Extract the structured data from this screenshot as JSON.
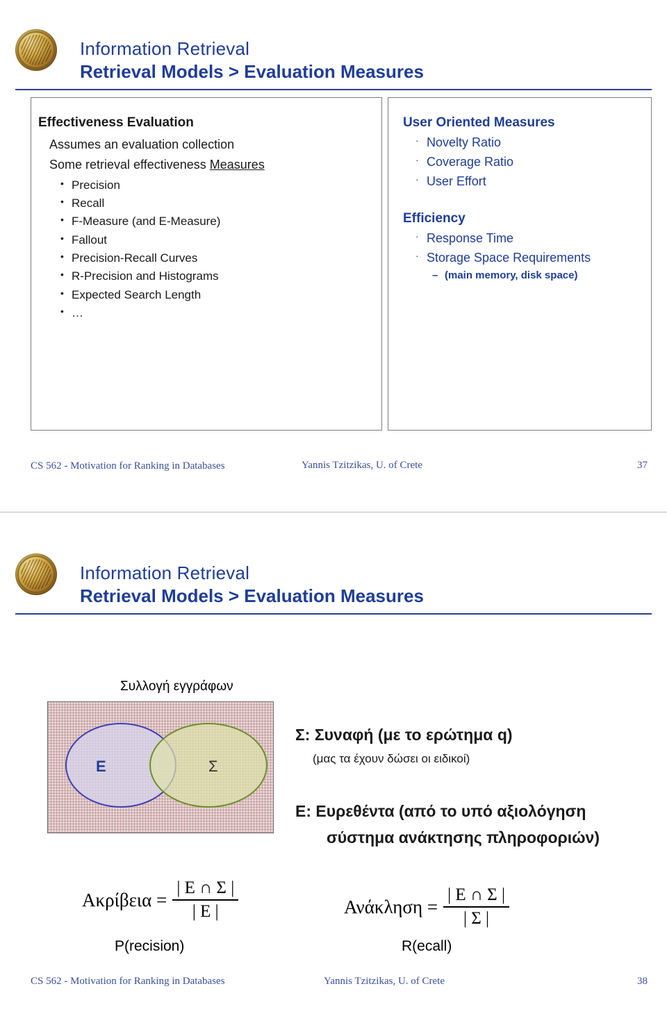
{
  "slide1": {
    "header": {
      "line1": "Information Retrieval",
      "line2": "Retrieval Models > Evaluation Measures"
    },
    "left_panel": {
      "heading": "Effectiveness Evaluation",
      "line_assumes": "Assumes an evaluation collection",
      "line_some_prefix": "Some retrieval effectiveness ",
      "line_some_underlined": "Measures",
      "bullets": [
        "Precision",
        "Recall",
        "F-Measure (and E-Measure)",
        "Fallout",
        "Precision-Recall Curves",
        "R-Precision and Histograms",
        "Expected Search Length",
        "…"
      ]
    },
    "right_panel": {
      "heading_user": "User Oriented Measures",
      "user_bullets": [
        "Novelty Ratio",
        "Coverage Ratio",
        "User Effort"
      ],
      "heading_efficiency": "Efficiency",
      "efficiency_bullets": [
        "Response Time",
        "Storage Space Requirements"
      ],
      "efficiency_subitem": "(main memory, disk space)"
    },
    "footer": {
      "left": "CS 562 - Motivation for Ranking in Databases",
      "center": "Yannis Tzitzikas, U. of Crete",
      "page": "37"
    }
  },
  "slide2": {
    "header": {
      "line1": "Information Retrieval",
      "line2": "Retrieval Models > Evaluation Measures"
    },
    "venn": {
      "collection_label": "Συλλογή εγγράφων",
      "set_e": "Ε",
      "set_s": "Σ"
    },
    "legend": {
      "sigma_line": "Σ: Συναφή (με το ερώτημα q)",
      "sigma_sub": "(μας τα έχουν δώσει οι ειδικοί)",
      "epsilon_line1": "Ε: Ευρεθέντα (από το υπό αξιολόγηση",
      "epsilon_line2": "σύστημα ανάκτησης πληροφοριών)"
    },
    "formulas": {
      "precision_name": "Ακρίβεια =",
      "precision_num": "| Ε ∩ Σ |",
      "precision_den": "| Ε |",
      "precision_caption": "P(recision)",
      "recall_name": "Ανάκληση =",
      "recall_num": "| Ε ∩ Σ |",
      "recall_den": "| Σ |",
      "recall_caption": "R(ecall)"
    },
    "footer": {
      "left": "CS 562 - Motivation for Ranking in Databases",
      "center": "Yannis Tzitzikas, U. of Crete",
      "page": "38"
    }
  }
}
